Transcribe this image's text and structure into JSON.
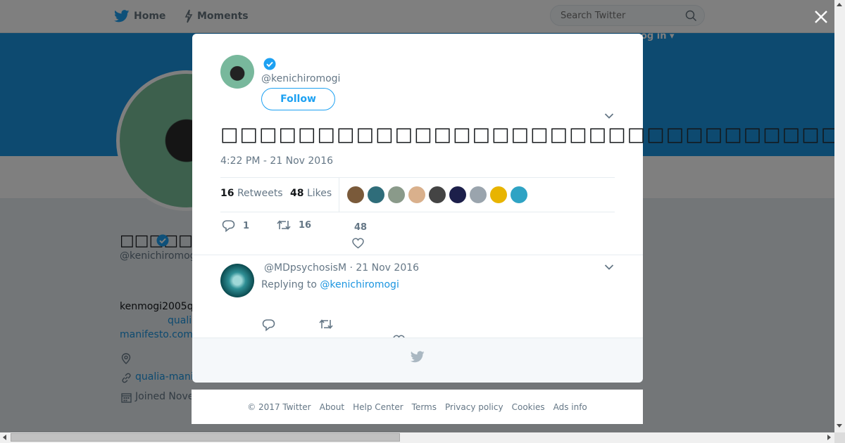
{
  "topbar": {
    "home_label": "Home",
    "moments_label": "Moments",
    "search_placeholder": "Search Twitter",
    "login_label": "og in ▾"
  },
  "profile": {
    "name": "□□□□□",
    "handle": "@kenichiromogi",
    "bio": "kenmogi2005q",
    "link_fragment": "quali",
    "link_domain": "manifesto.com",
    "url": "qualia-mani",
    "joined": "Joined Nove"
  },
  "tweet": {
    "handle": "@kenichiromogi",
    "follow_label": "Follow",
    "text": "□□□□□□□□□□□□□□□□□□□□□□□□□□□□□□□□□□□□□□□□□□□□□□□□□□□□□□□□□",
    "timestamp": "4:22 PM - 21 Nov 2016",
    "retweet_count": "16",
    "retweets_label": "Retweets",
    "like_count": "48",
    "likes_label": "Likes",
    "actions": {
      "reply_count": "1",
      "retweet_count": "16",
      "like_count": "48"
    },
    "likers": [
      {
        "name": "liker-1",
        "color": "#7a5a3a"
      },
      {
        "name": "liker-2",
        "color": "#2f6d7a"
      },
      {
        "name": "liker-3",
        "color": "#8a9a8a"
      },
      {
        "name": "liker-4",
        "color": "#d9b08c"
      },
      {
        "name": "liker-5",
        "color": "#444444"
      },
      {
        "name": "liker-6",
        "color": "#1c1f4a"
      },
      {
        "name": "liker-7",
        "color": "#9aa4ad"
      },
      {
        "name": "liker-8",
        "color": "#e8b400"
      },
      {
        "name": "liker-9",
        "color": "#2fa3c4"
      }
    ]
  },
  "reply": {
    "header": "@MDpsychosisM · 21 Nov 2016",
    "replying_prefix": "Replying to",
    "replying_to": "@kenichiromogi"
  },
  "footer": {
    "links": [
      "© 2017 Twitter",
      "About",
      "Help Center",
      "Terms",
      "Privacy policy",
      "Cookies",
      "Ads info"
    ]
  },
  "colors": {
    "accent": "#1da1f2",
    "banner": "#1b95e0",
    "muted_text": "#657786"
  }
}
